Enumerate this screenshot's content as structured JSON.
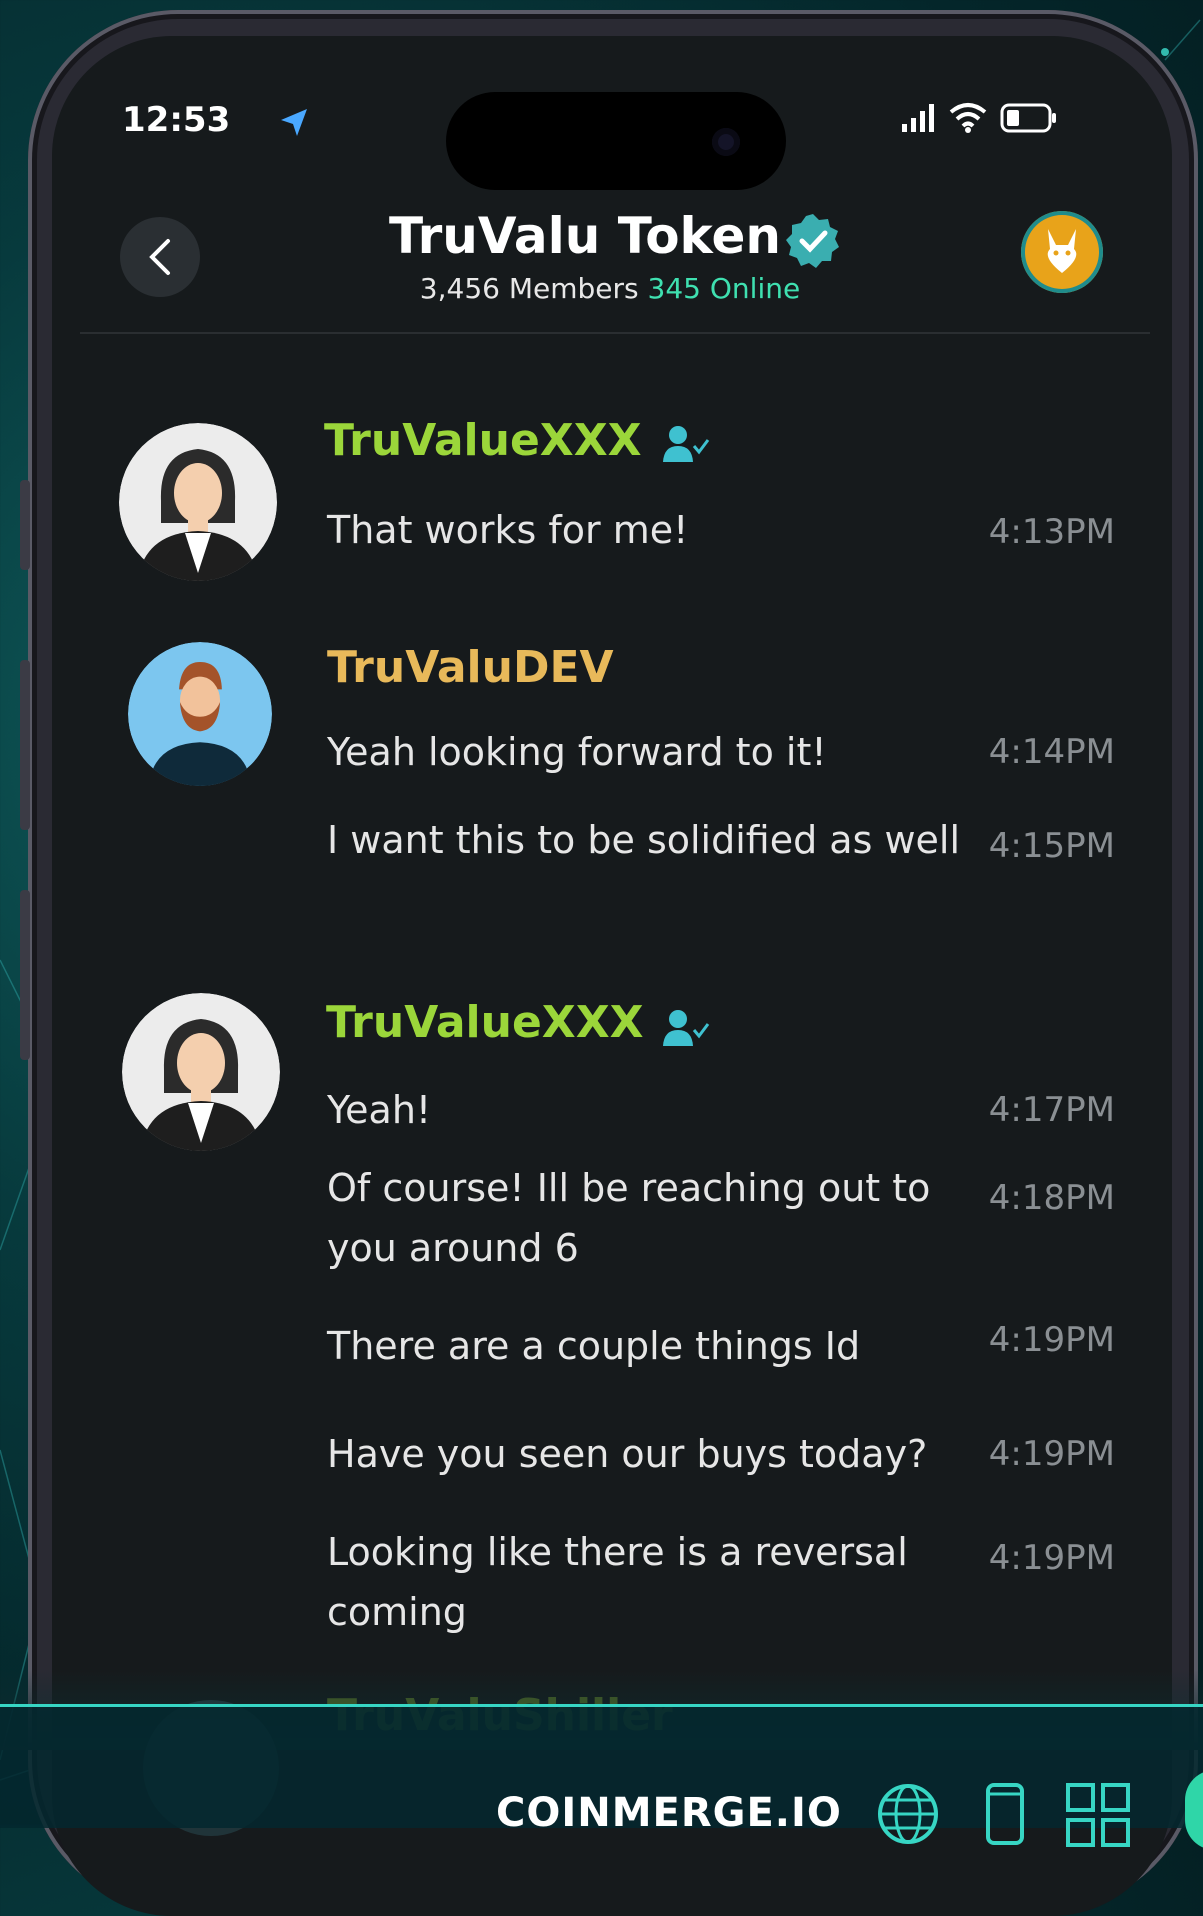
{
  "status_bar": {
    "time": "12:53"
  },
  "header": {
    "title": "TruValu Token",
    "members": "3,456 Members",
    "online": "345 Online"
  },
  "messages": [
    {
      "user": "TruValueXXX",
      "name_color": "#9bd63a",
      "verified_user": true,
      "lines": [
        {
          "text": "That works for me!",
          "time": "4:13PM"
        }
      ]
    },
    {
      "user": "TruValuDEV",
      "name_color": "#e8b95a",
      "verified_user": false,
      "lines": [
        {
          "text": "Yeah looking forward to it!",
          "time": "4:14PM"
        },
        {
          "text": "I want this to be solidified as well",
          "time": "4:15PM"
        }
      ]
    },
    {
      "user": "TruValueXXX",
      "name_color": "#9bd63a",
      "verified_user": true,
      "lines": [
        {
          "text": "Yeah!",
          "time": "4:17PM"
        },
        {
          "text": "Of course! Ill be reaching out to you around 6",
          "time": "4:18PM"
        },
        {
          "text": "There are a couple things Id",
          "time": "4:19PM"
        },
        {
          "text": "Have you seen our buys today?",
          "time": "4:19PM"
        },
        {
          "text": "Looking like there is a reversal coming",
          "time": "4:19PM"
        }
      ]
    },
    {
      "user": "TruValuShiller",
      "name_color": "#9bd63a",
      "verified_user": false,
      "lines": []
    }
  ],
  "footer": {
    "brand": "COINMERGE.IO"
  },
  "colors": {
    "accent": "#37d6c4",
    "online": "#3fe0b0",
    "background": "#161a1c"
  },
  "icons": [
    "location-arrow-icon",
    "signal-icon",
    "wifi-icon",
    "battery-icon",
    "chevron-left-icon",
    "verified-badge-icon",
    "group-avatar-icon",
    "user-check-icon",
    "globe-icon",
    "mobile-icon",
    "grid-icon"
  ]
}
